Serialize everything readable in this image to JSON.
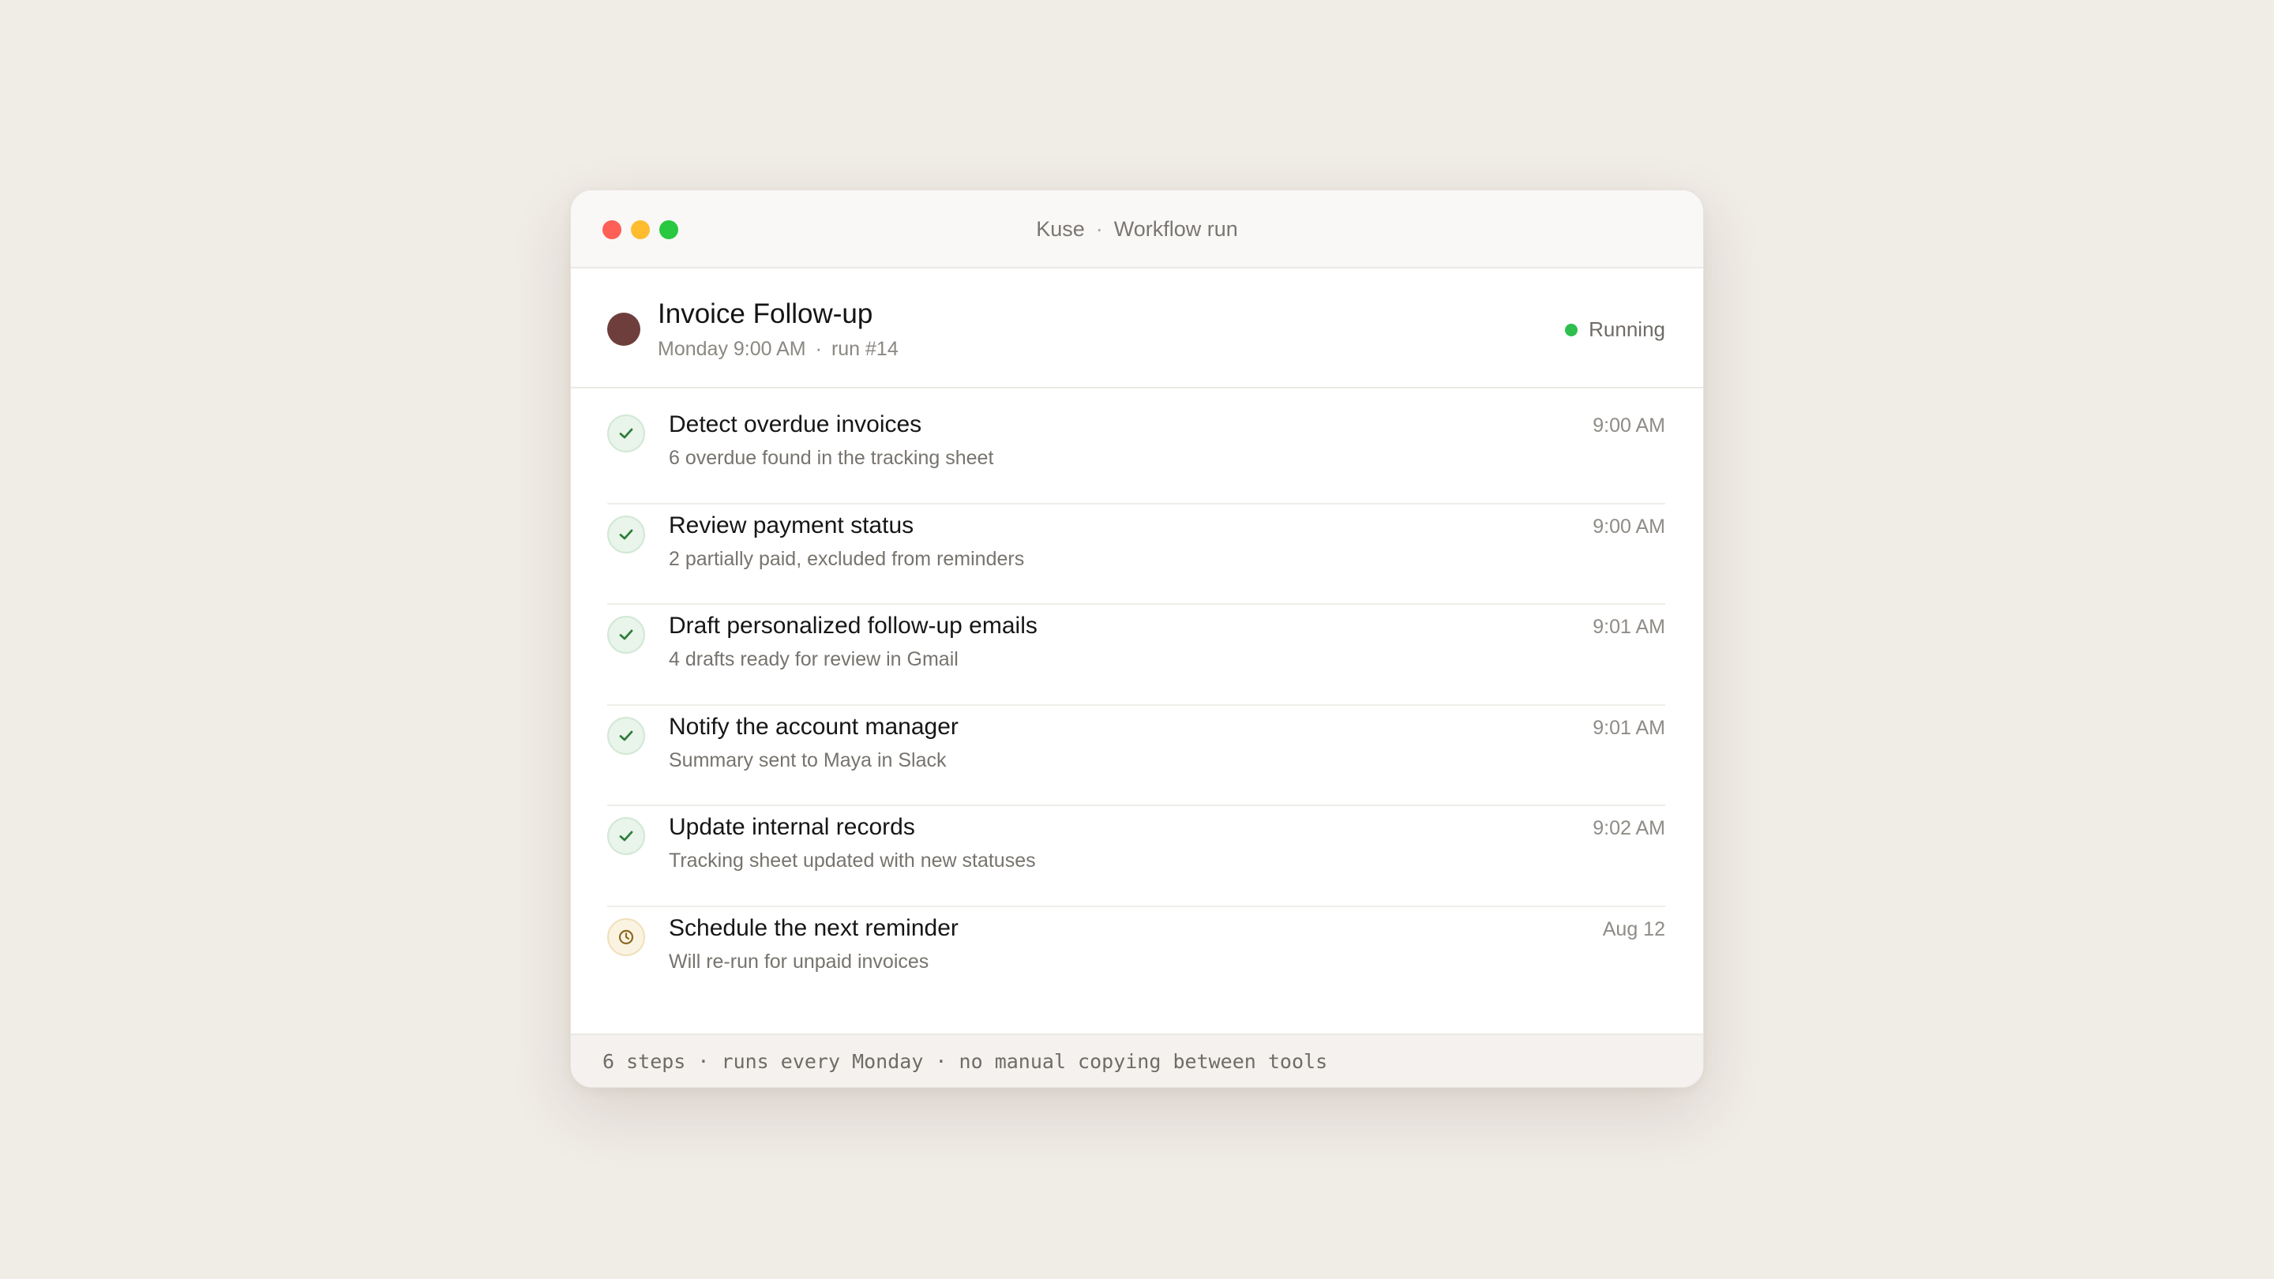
{
  "window": {
    "app_name": "Kuse",
    "separator": "·",
    "view_name": "Workflow run"
  },
  "workflow": {
    "name": "Invoice Follow-up",
    "schedule": "Monday 9:00 AM",
    "separator": "·",
    "run": "run #14",
    "status": "Running",
    "colors": {
      "avatar": "#6e3e3d",
      "status_dot": "#2fbf4f"
    }
  },
  "steps": [
    {
      "title": "Detect overdue invoices",
      "desc": "6 overdue found in the tracking sheet",
      "time": "9:00 AM",
      "state": "done",
      "icon": "check-icon"
    },
    {
      "title": "Review payment status",
      "desc": "2 partially paid, excluded from reminders",
      "time": "9:00 AM",
      "state": "done",
      "icon": "check-icon"
    },
    {
      "title": "Draft personalized follow-up emails",
      "desc": "4 drafts ready for review in Gmail",
      "time": "9:01 AM",
      "state": "done",
      "icon": "check-icon"
    },
    {
      "title": "Notify the account manager",
      "desc": "Summary sent to Maya in Slack",
      "time": "9:01 AM",
      "state": "done",
      "icon": "check-icon"
    },
    {
      "title": "Update internal records",
      "desc": "Tracking sheet updated with new statuses",
      "time": "9:02 AM",
      "state": "done",
      "icon": "check-icon"
    },
    {
      "title": "Schedule the next reminder",
      "desc": "Will re-run for unpaid invoices",
      "time": "Aug 12",
      "state": "pending",
      "icon": "clock-icon"
    }
  ],
  "footer": {
    "text": "6 steps · runs every Monday · no manual copying between tools"
  }
}
